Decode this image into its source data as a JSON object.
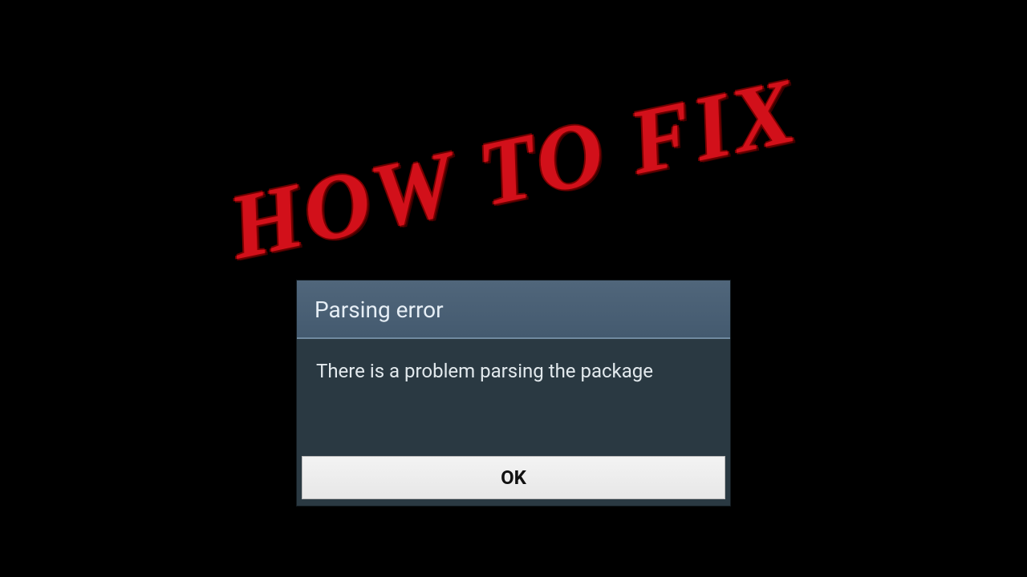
{
  "overlay": {
    "graffiti_text": "HOW TO FIX"
  },
  "dialog": {
    "title": "Parsing error",
    "message": "There is a problem parsing the package",
    "ok_label": "OK"
  }
}
